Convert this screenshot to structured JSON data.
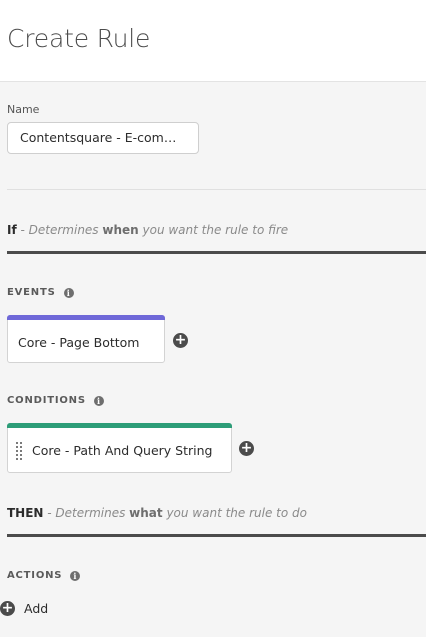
{
  "header": {
    "title": "Create Rule"
  },
  "name_field": {
    "label": "Name",
    "value": "Contentsquare - E-commer..."
  },
  "if_section": {
    "keyword": "If",
    "dash": " - Determines ",
    "emphasis": "when",
    "rest": " you want the rule to fire"
  },
  "events": {
    "label": "EVENTS",
    "items": [
      {
        "label": "Core - Page Bottom",
        "accent": "#6f68d8"
      }
    ]
  },
  "conditions": {
    "label": "CONDITIONS",
    "items": [
      {
        "label": "Core - Path And Query String",
        "accent": "#2d9d78"
      }
    ]
  },
  "then_section": {
    "keyword": "THEN",
    "dash": " - Determines ",
    "emphasis": "what",
    "rest": " you want the rule to do"
  },
  "actions": {
    "label": "ACTIONS",
    "add_label": "Add"
  },
  "icons": {
    "info": "info-icon",
    "add": "plus-circle-icon",
    "drag": "drag-handle-icon"
  }
}
